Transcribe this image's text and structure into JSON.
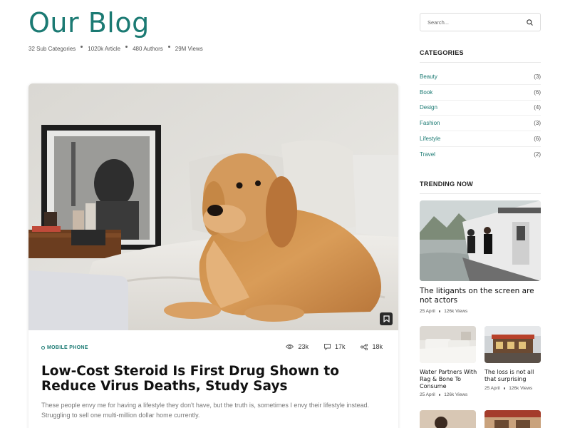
{
  "header": {
    "title": "Our Blog",
    "stats": [
      "32 Sub Categories",
      "1020k Article",
      "480 Authors",
      "29M Views"
    ]
  },
  "featured": {
    "category": "MOBILE PHONE",
    "views": "23k",
    "comments": "17k",
    "shares": "18k",
    "title": "Low-Cost Steroid Is First Drug Shown to Reduce Virus Deaths, Study Says",
    "excerpt": "These people envy me for having a lifestyle they don't have, but the truth is, sometimes I envy their lifestyle instead. Struggling to sell one multi-million dollar home currently."
  },
  "search": {
    "placeholder": "Search..."
  },
  "sidebar": {
    "categories_heading": "CATEGORIES",
    "categories": [
      {
        "name": "Beauty",
        "count": "(3)"
      },
      {
        "name": "Book",
        "count": "(6)"
      },
      {
        "name": "Design",
        "count": "(4)"
      },
      {
        "name": "Fashion",
        "count": "(3)"
      },
      {
        "name": "Lifestyle",
        "count": "(6)"
      },
      {
        "name": "Travel",
        "count": "(2)"
      }
    ],
    "trending_heading": "TRENDING NOW",
    "trending_main": {
      "title": "The litigants on the screen are not actors",
      "date": "25 April",
      "views": "126k Views"
    },
    "trending_small": [
      {
        "title": "Water Partners With Rag & Bone To Consume",
        "date": "25 April",
        "views": "126k Views"
      },
      {
        "title": "The loss is not all that surprising",
        "date": "25 April",
        "views": "126k Views"
      }
    ]
  },
  "colors": {
    "accent": "#1b7a73"
  }
}
